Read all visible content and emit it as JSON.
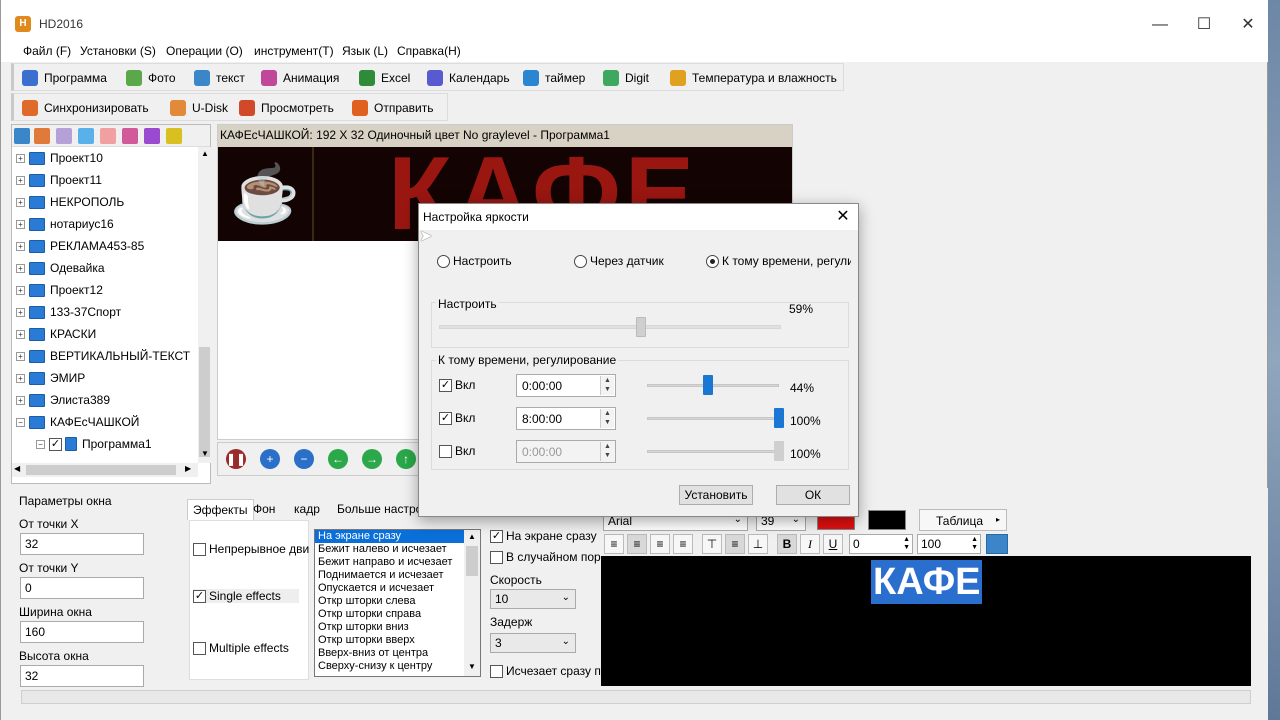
{
  "window": {
    "title": "HD2016",
    "minimize": "—",
    "maximize": "☐",
    "close": "✕"
  },
  "menu": [
    "Файл (F)",
    "Установки (S)",
    "Операции (O)",
    "инструмент(T)",
    "Язык (L)",
    "Справка(H)"
  ],
  "toolbar1": [
    {
      "label": "Программа",
      "icon": "program-icon",
      "color": "#3a6fd0"
    },
    {
      "label": "Фото",
      "icon": "photo-icon",
      "color": "#5aa84a"
    },
    {
      "label": "текст",
      "icon": "text-icon",
      "color": "#3a86c8"
    },
    {
      "label": "Анимация",
      "icon": "animation-icon",
      "color": "#c0479a"
    },
    {
      "label": "Excel",
      "icon": "excel-icon",
      "color": "#2e8b3a"
    },
    {
      "label": "Календарь",
      "icon": "calendar-icon",
      "color": "#5a5ad0"
    },
    {
      "label": "таймер",
      "icon": "timer-icon",
      "color": "#2a86d0"
    },
    {
      "label": "Digit",
      "icon": "digit-icon",
      "color": "#3fa860"
    },
    {
      "label": "Температура и влажность",
      "icon": "thermometer-icon",
      "color": "#e0a020"
    }
  ],
  "toolbar2": [
    {
      "label": "Синхронизировать",
      "icon": "sync-icon",
      "color": "#e06a2a"
    },
    {
      "label": "U-Disk",
      "icon": "usb-icon",
      "color": "#e08a3a"
    },
    {
      "label": "Просмотреть",
      "icon": "preview-icon",
      "color": "#d04a2a"
    },
    {
      "label": "Отправить",
      "icon": "send-icon",
      "color": "#e06020"
    }
  ],
  "tree": {
    "items": [
      "Проект10",
      "Проект11",
      "НЕКРОПОЛЬ",
      "нотариус16",
      "РЕКЛАМА453-85",
      "Одевайка",
      "Проект12",
      "133-37Спорт",
      "КРАСКИ",
      "ВЕРТИКАЛЬНЫЙ-ТЕКСТ",
      "ЭМИР",
      "Элиста389",
      "КАФЕсЧАШКОЙ"
    ],
    "child": "Программа1"
  },
  "preview": {
    "header": "КАФЕсЧАШКОЙ: 192 X 32  Одиночный цвет No graylevel - Программа1",
    "led_text": "КАФЕ"
  },
  "params": {
    "title": "Параметры окна",
    "fields": [
      {
        "label": "От точки X",
        "value": "32"
      },
      {
        "label": "От точки Y",
        "value": "0"
      },
      {
        "label": "Ширина окна",
        "value": "160"
      },
      {
        "label": "Высота окна",
        "value": "32"
      }
    ]
  },
  "tabs": [
    "Эффекты",
    "Фон",
    "кадр",
    "Больше настрое"
  ],
  "effects": {
    "continuous": "Непрерывное дви",
    "single": "Single effects",
    "multiple": "Multiple effects"
  },
  "effect_list": [
    "На экране сразу",
    "Бежит налево и исчезает",
    "Бежит направо и исчезает",
    "Поднимается и исчезает",
    "Опускается и исчезает",
    "Откр шторки слева",
    "Откр шторки справа",
    "Откр шторки вниз",
    "Откр шторки вверх",
    "Вверх-вниз от центра",
    "Сверху-снизу к центру"
  ],
  "effect_opts": {
    "on_screen": "На экране сразу",
    "random": "В случайном пор",
    "speed_label": "Скорость",
    "speed": "10",
    "delay_label": "Задерж",
    "delay": "3",
    "vanish": "Исчезает сразу п"
  },
  "format": {
    "font": "Arial",
    "size": "39",
    "text_color": "#e01010",
    "bg_color": "#000000",
    "table_label": "Таблица",
    "spacing": "0",
    "scale": "100",
    "bold": "B",
    "italic": "I",
    "underline": "U"
  },
  "editor_text": "КАФЕ",
  "dialog": {
    "title": "Настройка яркости",
    "close": "✕",
    "radio_manual": "Настроить",
    "radio_sensor": "Через датчик",
    "radio_time": "К тому времени, регулиро",
    "manual_group": "Настроить",
    "manual_pct": "59%",
    "manual_level": 0.59,
    "time_group": "К тому времени, регулирование",
    "rows": [
      {
        "enabled": true,
        "label": "Вкл",
        "time": "0:00:00",
        "pct": "44%",
        "level": 0.44
      },
      {
        "enabled": true,
        "label": "Вкл",
        "time": "8:00:00",
        "pct": "100%",
        "level": 1.0
      },
      {
        "enabled": false,
        "label": "Вкл",
        "time": "0:00:00",
        "pct": "100%",
        "level": 1.0
      }
    ],
    "btn_set": "Установить",
    "btn_ok": "ОК"
  }
}
